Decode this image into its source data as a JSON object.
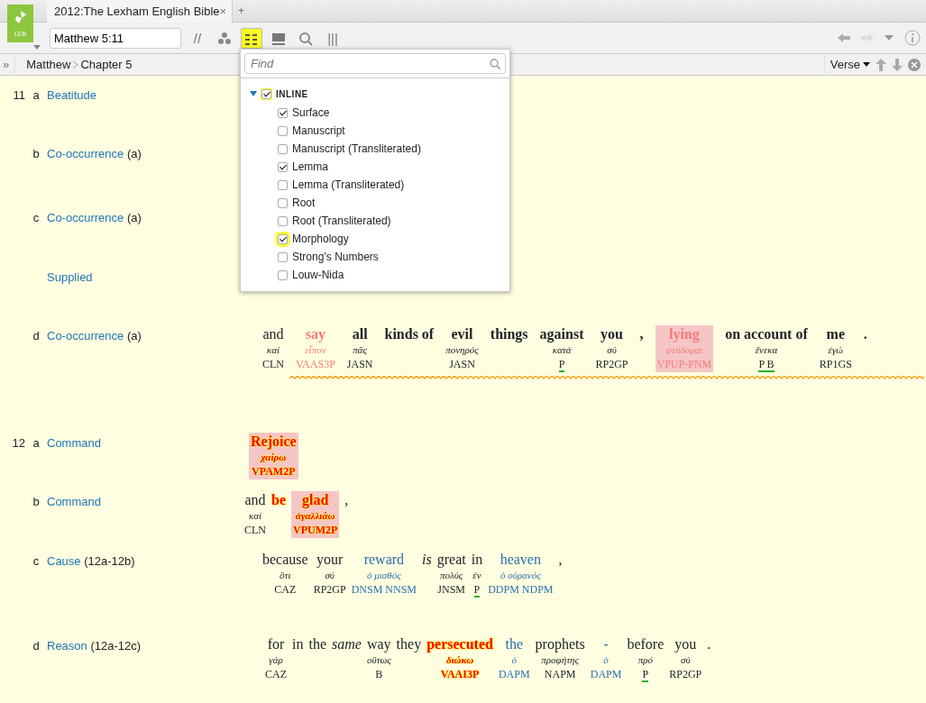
{
  "app": {
    "logo_text": "LEB"
  },
  "tab": {
    "title": "2012:The Lexham English Bible",
    "close": "×",
    "new": "+"
  },
  "toolbar": {
    "reference": "Matthew 5:11",
    "tools": [
      {
        "kind": "text",
        "label": "//",
        "selected": false
      },
      {
        "kind": "dots",
        "selected": false
      },
      {
        "kind": "grid",
        "selected": true
      },
      {
        "kind": "panel",
        "selected": false
      },
      {
        "kind": "search",
        "selected": false
      },
      {
        "kind": "text",
        "label": "|||",
        "selected": false
      }
    ]
  },
  "nav": {
    "expand": "»",
    "crumbs": [
      "Matthew",
      "Chapter 5"
    ],
    "view": "Verse"
  },
  "dropdown": {
    "placeholder": "Find",
    "group": {
      "label": "INLINE",
      "checked": true,
      "expanded": true,
      "children": [
        {
          "label": "Surface",
          "checked": true
        },
        {
          "label": "Manuscript",
          "checked": false
        },
        {
          "label": "Manuscript (Transliterated)",
          "checked": false
        },
        {
          "label": "Lemma",
          "checked": true
        },
        {
          "label": "Lemma (Transliterated)",
          "checked": false
        },
        {
          "label": "Root",
          "checked": false
        },
        {
          "label": "Root (Transliterated)",
          "checked": false
        },
        {
          "label": "Morphology",
          "checked": true
        },
        {
          "label": "Strong’s Numbers",
          "checked": false
        },
        {
          "label": "Louw-Nida",
          "checked": false
        }
      ]
    }
  },
  "verses": [
    {
      "number": "11",
      "letter": "a",
      "label": "Beatitude"
    },
    {
      "letter": "b",
      "label": "Co-occurrence",
      "note": "(a)"
    },
    {
      "letter": "c",
      "label": "Co-occurrence",
      "note": "(a)"
    },
    {
      "label": "Supplied"
    },
    {
      "letter": "d",
      "label": "Co-occurrence",
      "note": "(a)",
      "wavy": true,
      "words": [
        {
          "surface": "and",
          "lemma": "καί",
          "morph": "CLN",
          "kind": "plain"
        },
        {
          "surface": "say",
          "lemma": "εἶπον",
          "morph": "VAAS3P",
          "kind": "pink"
        },
        {
          "surface": "all",
          "lemma": "πᾶς",
          "morph": "JASN",
          "kind": "bold"
        },
        {
          "surface": "kinds of",
          "kind": "bold"
        },
        {
          "surface": "evil",
          "lemma": "πονηρός",
          "morph": "JASN",
          "kind": "bold"
        },
        {
          "surface": "things",
          "kind": "bold"
        },
        {
          "surface": "against",
          "lemma": "κατά",
          "morph": "P",
          "kind": "bold",
          "underline": true
        },
        {
          "surface": "you",
          "lemma": "σύ",
          "morph": "RP2GP",
          "kind": "bold"
        },
        {
          "surface": ",",
          "kind": "bold"
        },
        {
          "surface": "lying",
          "lemma": "ψεύδομαι",
          "morph": "VPUP-PNM",
          "kind": "pink",
          "boxed": true
        },
        {
          "surface": "on account of",
          "lemma": "ἕνεκα",
          "morph": "P B",
          "kind": "bold",
          "underline": true
        },
        {
          "surface": "me",
          "lemma": "ἐγώ",
          "morph": "RP1GS",
          "kind": "bold"
        },
        {
          "surface": ".",
          "kind": "bold"
        }
      ]
    },
    {
      "number": "12",
      "letter": "a",
      "label": "Command",
      "words": [
        {
          "surface": "Rejoice",
          "lemma": "χαίρω",
          "morph": "VPAM2P",
          "kind": "red",
          "boxed": true
        }
      ]
    },
    {
      "letter": "b",
      "label": "Command",
      "words": [
        {
          "surface": "and",
          "lemma": "καί",
          "morph": "CLN",
          "kind": "plain"
        },
        {
          "surface": "be",
          "kind": "red"
        },
        {
          "surface": "glad",
          "lemma": "ἀγαλλιάω",
          "morph": "VPUM2P",
          "kind": "red",
          "boxed": true
        },
        {
          "surface": ",",
          "kind": "plain"
        }
      ]
    },
    {
      "letter": "c",
      "label": "Cause",
      "note": "(12a-12b)",
      "words": [
        {
          "surface": "because",
          "lemma": "ὅτι",
          "morph": "CAZ",
          "kind": "plain"
        },
        {
          "surface": "your",
          "lemma": "σύ",
          "morph": "RP2GP",
          "kind": "plain"
        },
        {
          "surface": "reward",
          "lemma": "ὁ μισθός",
          "morph": "DNSM NNSM",
          "kind": "blue"
        },
        {
          "surface": "is",
          "kind": "italic"
        },
        {
          "surface": "great",
          "lemma": "πολύς",
          "morph": "JNSM",
          "kind": "plain"
        },
        {
          "surface": "in",
          "lemma": "ἐν",
          "morph": "P",
          "kind": "plain",
          "underline": true
        },
        {
          "surface": "heaven",
          "lemma": "ὁ οὐρανός",
          "morph": "DDPM NDPM",
          "kind": "blue"
        },
        {
          "surface": ",",
          "kind": "plain"
        }
      ]
    },
    {
      "letter": "d",
      "label": "Reason",
      "note": "(12a-12c)",
      "words": [
        {
          "surface": "for",
          "lemma": "γάρ",
          "morph": "CAZ",
          "kind": "plain"
        },
        {
          "surface": "in",
          "kind": "plain"
        },
        {
          "surface": "the",
          "kind": "plain"
        },
        {
          "surface": "same",
          "kind": "italic"
        },
        {
          "surface": "way",
          "lemma": "οὕτως",
          "morph": "B",
          "kind": "plain"
        },
        {
          "surface": "they",
          "kind": "plain"
        },
        {
          "surface": "persecuted",
          "lemma": "διώκω",
          "morph": "VAAI3P",
          "kind": "red"
        },
        {
          "surface": "the",
          "lemma": "ὁ",
          "morph": "DAPM",
          "kind": "blue"
        },
        {
          "surface": "prophets",
          "lemma": "προφήτης",
          "morph": "NAPM",
          "kind": "plain"
        },
        {
          "surface": "-",
          "lemma": "ὁ",
          "morph": "DAPM",
          "kind": "blue"
        },
        {
          "surface": "before",
          "lemma": "πρό",
          "morph": "P",
          "kind": "plain",
          "underline": true
        },
        {
          "surface": "you",
          "lemma": "σύ",
          "morph": "RP2GP",
          "kind": "plain"
        },
        {
          "surface": ".",
          "kind": "plain"
        }
      ]
    }
  ]
}
